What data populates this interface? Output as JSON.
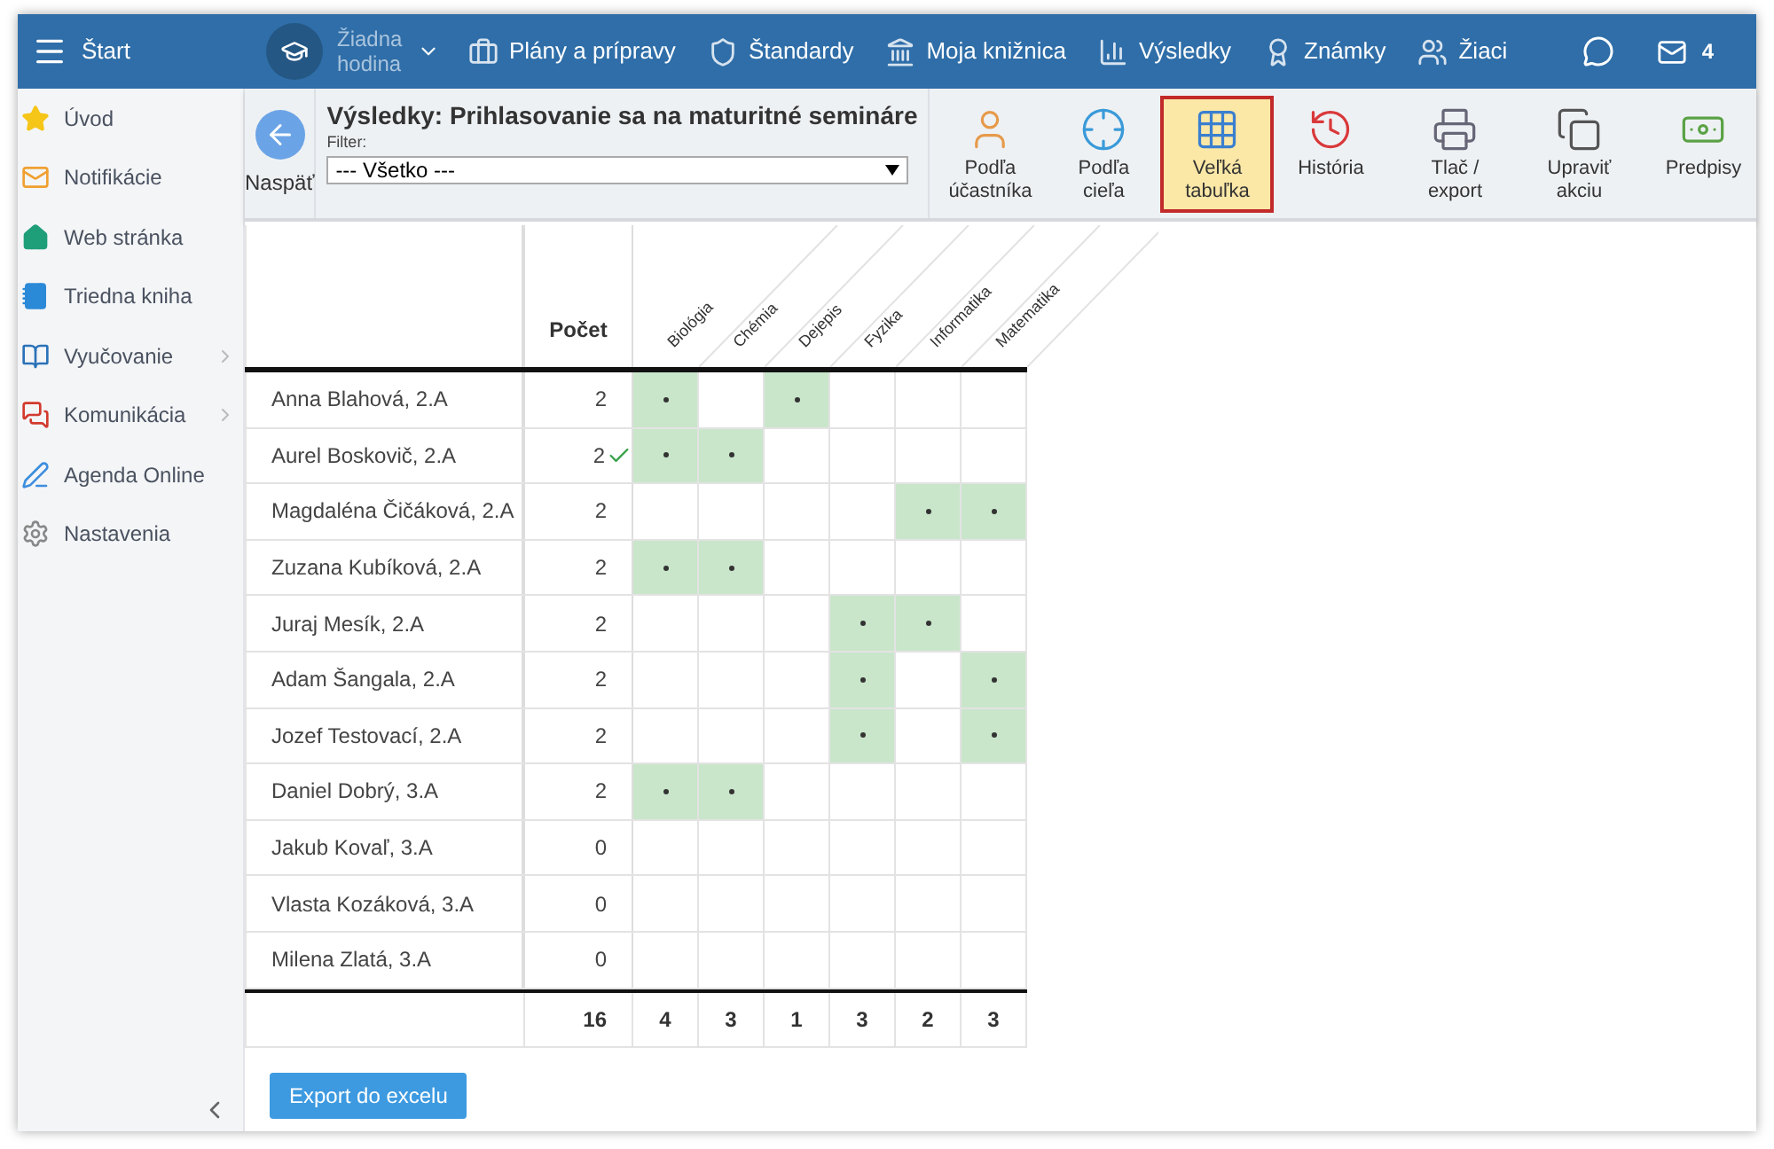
{
  "topbar": {
    "title": "Štart",
    "lesson": "Žiadna hodina",
    "nav": [
      {
        "kind": "briefcase",
        "label": "Plány a prípravy"
      },
      {
        "kind": "shield",
        "label": "Štandardy"
      },
      {
        "kind": "library",
        "label": "Moja knižnica"
      },
      {
        "kind": "chart",
        "label": "Výsledky"
      },
      {
        "kind": "grade",
        "label": "Známky"
      },
      {
        "kind": "pupils",
        "label": "Žiaci"
      }
    ],
    "mail_count": "4"
  },
  "sidebar": {
    "items": [
      {
        "kind": "star",
        "label": "Úvod",
        "expandable": false
      },
      {
        "kind": "mail",
        "label": "Notifikácie",
        "expandable": false
      },
      {
        "kind": "home",
        "label": "Web stránka",
        "expandable": false
      },
      {
        "kind": "notebook",
        "label": "Triedna kniha",
        "expandable": false
      },
      {
        "kind": "book",
        "label": "Vyučovanie",
        "expandable": true
      },
      {
        "kind": "chat",
        "label": "Komunikácia",
        "expandable": true
      },
      {
        "kind": "pen",
        "label": "Agenda Online",
        "expandable": false
      },
      {
        "kind": "gear",
        "label": "Nastavenia",
        "expandable": false
      }
    ]
  },
  "toolbar": {
    "back": "Naspäť",
    "title": "Výsledky: Prihlasovanie sa na maturitné semináre",
    "filter_label": "Filter:",
    "filter_value": "--- Všetko ---",
    "buttons": [
      {
        "kind": "person",
        "label": "Podľa účastníka",
        "selected": false
      },
      {
        "kind": "target",
        "label": "Podľa cieľa",
        "selected": false
      },
      {
        "kind": "grid",
        "label": "Veľká tabuľka",
        "selected": true
      },
      {
        "kind": "history",
        "label": "História",
        "selected": false
      },
      {
        "kind": "print",
        "label": "Tlač / export",
        "selected": false
      },
      {
        "kind": "edit",
        "label": "Upraviť akciu",
        "selected": false
      },
      {
        "kind": "money",
        "label": "Predpisy",
        "selected": false
      }
    ]
  },
  "table": {
    "count_header": "Počet",
    "subjects": [
      "Biológia",
      "Chémia",
      "Dejepis",
      "Fyzika",
      "Informatika",
      "Matematika"
    ],
    "rows": [
      {
        "name": "Anna Blahová, 2.A",
        "count": "2",
        "confirmed": false,
        "marks": [
          {
            "on": true
          },
          {
            "on": false
          },
          {
            "on": true
          },
          {
            "on": false
          },
          {
            "on": false
          },
          {
            "on": false
          }
        ]
      },
      {
        "name": "Aurel Boskovič, 2.A",
        "count": "2",
        "confirmed": true,
        "marks": [
          {
            "on": true
          },
          {
            "on": true
          },
          {
            "on": false
          },
          {
            "on": false
          },
          {
            "on": false
          },
          {
            "on": false
          }
        ]
      },
      {
        "name": "Magdaléna Čičáková, 2.A",
        "count": "2",
        "confirmed": false,
        "marks": [
          {
            "on": false
          },
          {
            "on": false
          },
          {
            "on": false
          },
          {
            "on": false
          },
          {
            "on": true
          },
          {
            "on": true
          }
        ]
      },
      {
        "name": "Zuzana Kubíková, 2.A",
        "count": "2",
        "confirmed": false,
        "marks": [
          {
            "on": true
          },
          {
            "on": true
          },
          {
            "on": false
          },
          {
            "on": false
          },
          {
            "on": false
          },
          {
            "on": false
          }
        ]
      },
      {
        "name": "Juraj Mesík, 2.A",
        "count": "2",
        "confirmed": false,
        "marks": [
          {
            "on": false
          },
          {
            "on": false
          },
          {
            "on": false
          },
          {
            "on": true
          },
          {
            "on": true
          },
          {
            "on": false
          }
        ]
      },
      {
        "name": "Adam Šangala, 2.A",
        "count": "2",
        "confirmed": false,
        "marks": [
          {
            "on": false
          },
          {
            "on": false
          },
          {
            "on": false
          },
          {
            "on": true
          },
          {
            "on": false
          },
          {
            "on": true
          }
        ]
      },
      {
        "name": "Jozef Testovací, 2.A",
        "count": "2",
        "confirmed": false,
        "marks": [
          {
            "on": false
          },
          {
            "on": false
          },
          {
            "on": false
          },
          {
            "on": true
          },
          {
            "on": false
          },
          {
            "on": true
          }
        ]
      },
      {
        "name": "Daniel Dobrý, 3.A",
        "count": "2",
        "confirmed": false,
        "marks": [
          {
            "on": true
          },
          {
            "on": true
          },
          {
            "on": false
          },
          {
            "on": false
          },
          {
            "on": false
          },
          {
            "on": false
          }
        ]
      },
      {
        "name": "Jakub Kovaľ, 3.A",
        "count": "0",
        "confirmed": false,
        "marks": [
          {
            "on": false
          },
          {
            "on": false
          },
          {
            "on": false
          },
          {
            "on": false
          },
          {
            "on": false
          },
          {
            "on": false
          }
        ]
      },
      {
        "name": "Vlasta Kozáková, 3.A",
        "count": "0",
        "confirmed": false,
        "marks": [
          {
            "on": false
          },
          {
            "on": false
          },
          {
            "on": false
          },
          {
            "on": false
          },
          {
            "on": false
          },
          {
            "on": false
          }
        ]
      },
      {
        "name": "Milena Zlatá, 3.A",
        "count": "0",
        "confirmed": false,
        "marks": [
          {
            "on": false
          },
          {
            "on": false
          },
          {
            "on": false
          },
          {
            "on": false
          },
          {
            "on": false
          },
          {
            "on": false
          }
        ]
      }
    ],
    "totals": [
      "16",
      "4",
      "3",
      "1",
      "3",
      "2",
      "3"
    ]
  },
  "export_button": "Export do excelu"
}
